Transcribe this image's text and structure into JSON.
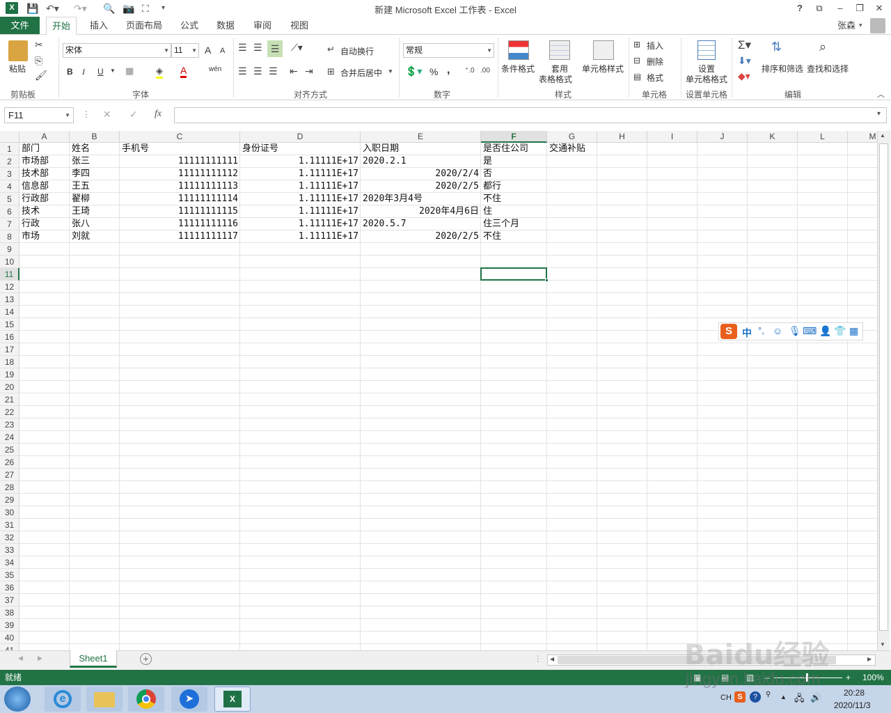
{
  "window": {
    "title": "新建 Microsoft Excel 工作表 - Excel",
    "app_icon": "X",
    "help": "?",
    "user": "张森"
  },
  "ribbon_tabs": [
    "文件",
    "开始",
    "插入",
    "页面布局",
    "公式",
    "数据",
    "审阅",
    "视图"
  ],
  "ribbon": {
    "clipboard": {
      "paste": "粘贴",
      "group": "剪贴板"
    },
    "font": {
      "name": "宋体",
      "size": "11",
      "bold": "B",
      "italic": "I",
      "underline": "U",
      "grow": "A",
      "shrink": "A",
      "color_letter": "A",
      "phonetic": "wén",
      "group": "字体"
    },
    "alignment": {
      "wrap": "自动换行",
      "merge": "合并后居中",
      "group": "对齐方式"
    },
    "number": {
      "format": "常规",
      "percent": "%",
      "comma": ",",
      "group": "数字"
    },
    "styles": {
      "conditional": "条件格式",
      "table_l1": "套用",
      "table_l2": "表格格式",
      "cell_styles": "单元格样式",
      "group": "样式"
    },
    "cells": {
      "insert": "插入",
      "delete": "删除",
      "format": "格式",
      "group": "单元格"
    },
    "format_cells": {
      "l1": "设置",
      "l2": "单元格格式",
      "group": "设置单元格"
    },
    "editing": {
      "sort": "排序和筛选",
      "find": "查找和选择",
      "group": "编辑"
    }
  },
  "formula_bar": {
    "name_box": "F11",
    "fx": "fx",
    "value": ""
  },
  "columns": [
    "A",
    "B",
    "C",
    "D",
    "E",
    "F",
    "G",
    "H",
    "I",
    "J",
    "K",
    "L",
    "M"
  ],
  "rows": [
    "1",
    "2",
    "3",
    "4",
    "5",
    "6",
    "7",
    "8",
    "9",
    "10",
    "11",
    "12",
    "13",
    "14",
    "15",
    "16",
    "17",
    "18",
    "19",
    "20",
    "21",
    "22",
    "23",
    "24",
    "25",
    "26",
    "27",
    "28",
    "29",
    "30",
    "31",
    "32",
    "33",
    "34",
    "35",
    "36",
    "37",
    "38",
    "39",
    "40",
    "41"
  ],
  "selected_cell": "F11",
  "headers": [
    "部门",
    "姓名",
    "手机号",
    "身份证号",
    "入职日期",
    "是否住公司",
    "交通补贴"
  ],
  "data_rows": [
    {
      "dept": "市场部",
      "name": "张三",
      "phone": "11111111111",
      "id": "1.11111E+17",
      "date": "2020.2.1",
      "date_align": "left",
      "live": "是"
    },
    {
      "dept": "技术部",
      "name": "李四",
      "phone": "11111111112",
      "id": "1.11111E+17",
      "date": "2020/2/4",
      "date_align": "right",
      "live": "否"
    },
    {
      "dept": "信息部",
      "name": "王五",
      "phone": "11111111113",
      "id": "1.11111E+17",
      "date": "2020/2/5",
      "date_align": "right",
      "live": "都行"
    },
    {
      "dept": "行政部",
      "name": "翟柳",
      "phone": "11111111114",
      "id": "1.11111E+17",
      "date": "2020年3月4号",
      "date_align": "left",
      "live": "不住"
    },
    {
      "dept": "技术",
      "name": "王琦",
      "phone": "11111111115",
      "id": "1.11111E+17",
      "date": "2020年4月6日",
      "date_align": "right",
      "live": "住"
    },
    {
      "dept": "行政",
      "name": "张八",
      "phone": "11111111116",
      "id": "1.11111E+17",
      "date": "2020.5.7",
      "date_align": "left",
      "live": "住三个月"
    },
    {
      "dept": "市场",
      "name": "刘就",
      "phone": "11111111117",
      "id": "1.11111E+17",
      "date": "2020/2/5",
      "date_align": "right",
      "live": "不住"
    }
  ],
  "sheets": [
    "Sheet1"
  ],
  "status": {
    "ready": "就绪",
    "zoom": "100%"
  },
  "ime_bar": {
    "mode": "中"
  },
  "watermark": {
    "brand": "Baidu经验",
    "url": "jingyan.baidu.com"
  },
  "taskbar": {
    "time": "20:28",
    "date": "2020/11/3",
    "lang": "CH"
  },
  "colors": {
    "excel_green": "#217346",
    "selection": "#217346"
  }
}
